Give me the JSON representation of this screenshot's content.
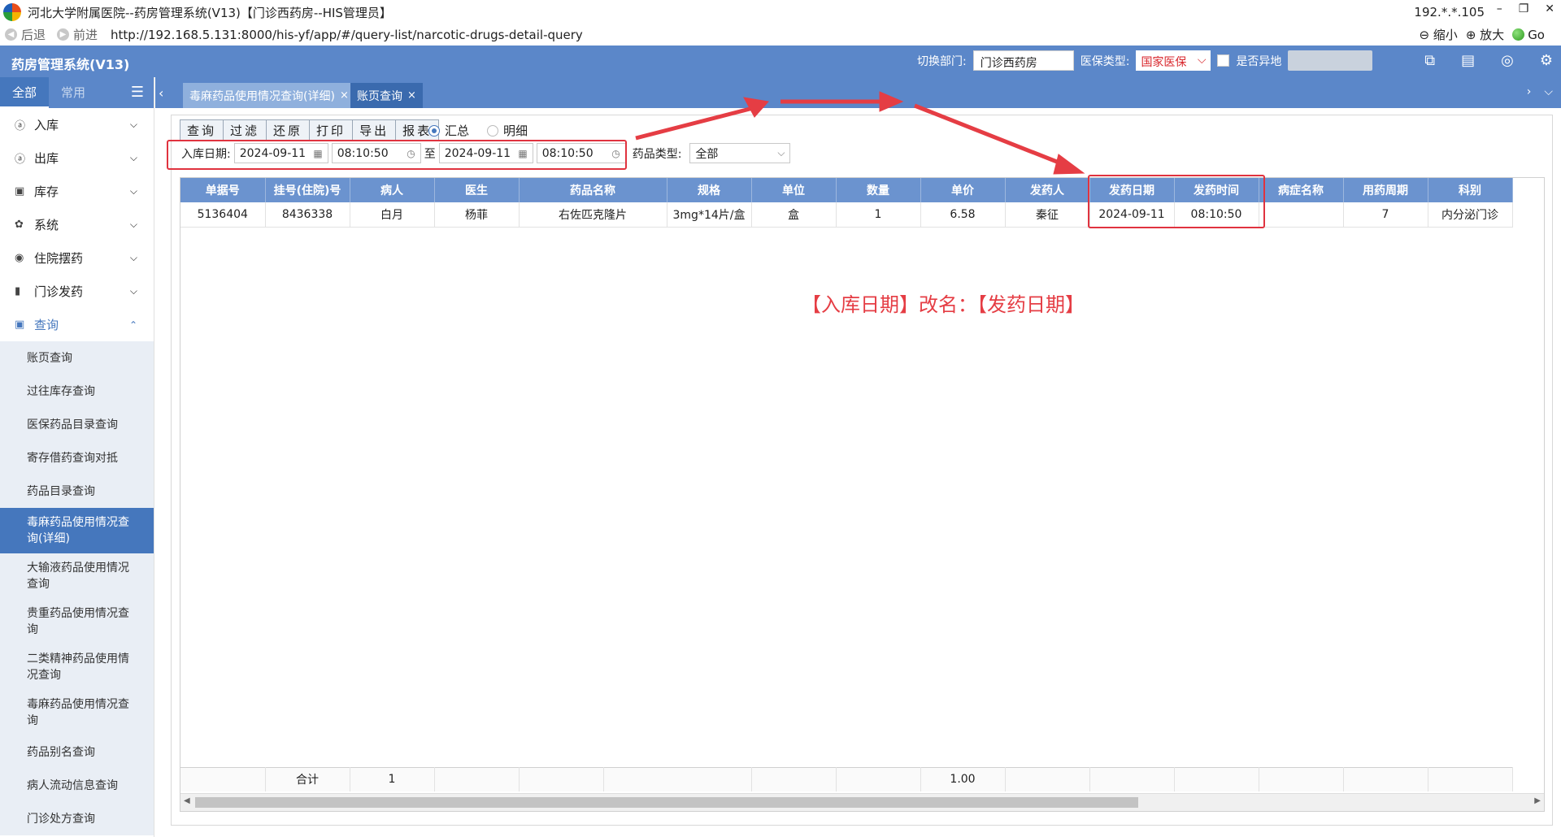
{
  "window": {
    "title": "河北大学附属医院--药房管理系统(V13)【门诊西药房--HIS管理员】",
    "ip": "192.*.*.105",
    "min": "–",
    "restore": "❐",
    "close": "✕"
  },
  "addressbar": {
    "back": "后退",
    "forward": "前进",
    "url": "http://192.168.5.131:8000/his-yf/app/#/query-list/narcotic-drugs-detail-query",
    "zoom_out": "缩小",
    "zoom_in": "放大",
    "go": "Go"
  },
  "header": {
    "app_title": "药房管理系统(V13)",
    "dept_label": "切换部门:",
    "dept_value": "门诊西药房",
    "insurance_label": "医保类型:",
    "insurance_value": "国家医保",
    "remote_label": "是否异地"
  },
  "sidebar": {
    "tabs": [
      "全部",
      "常用"
    ],
    "items": [
      {
        "label": "入库",
        "icon": "ⓐ"
      },
      {
        "label": "出库",
        "icon": "ⓐ"
      },
      {
        "label": "库存",
        "icon": "▣"
      },
      {
        "label": "系统",
        "icon": "✿"
      },
      {
        "label": "住院摆药",
        "icon": "◉"
      },
      {
        "label": "门诊发药",
        "icon": "▮"
      },
      {
        "label": "查询",
        "icon": "▣"
      }
    ],
    "submenu": [
      "账页查询",
      "过往库存查询",
      "医保药品目录查询",
      "寄存借药查询对抵",
      "药品目录查询",
      "毒麻药品使用情况查询(详细)",
      "大输液药品使用情况查询",
      "贵重药品使用情况查询",
      "二类精神药品使用情况查询",
      "毒麻药品使用情况查询",
      "药品别名查询",
      "病人流动信息查询",
      "门诊处方查询"
    ]
  },
  "tabs": [
    {
      "label": "毒麻药品使用情况查询(详细)",
      "close": "×"
    },
    {
      "label": "账页查询",
      "close": "×"
    }
  ],
  "toolbar": {
    "buttons": [
      "查询",
      "过滤",
      "还原",
      "打印",
      "导出",
      "报表"
    ],
    "radio_summary": "汇总",
    "radio_detail": "明细"
  },
  "filters": {
    "date_label": "入库日期:",
    "start_date": "2024-09-11",
    "start_time": "08:10:50",
    "to": "至",
    "end_date": "2024-09-11",
    "end_time": "08:10:50",
    "drug_type_label": "药品类型:",
    "drug_type_value": "全部"
  },
  "table": {
    "columns": [
      "单据号",
      "挂号(住院)号",
      "病人",
      "医生",
      "药品名称",
      "规格",
      "单位",
      "数量",
      "单价",
      "发药人",
      "发药日期",
      "发药时间",
      "病症名称",
      "用药周期",
      "科别"
    ],
    "rows": [
      [
        "5136404",
        "8436338",
        "白月",
        "杨菲",
        "右佐匹克隆片",
        "3mg*14片/盒",
        "盒",
        "1",
        "6.58",
        "秦征",
        "2024-09-11",
        "08:10:50",
        "",
        "7",
        "内分泌门诊"
      ]
    ],
    "footer": {
      "label": "合计",
      "count": "1",
      "qty": "1.00"
    }
  },
  "annotation": "【入库日期】改名：【发药日期】",
  "colors": {
    "header_blue": "#5b87c9",
    "active_blue": "#4577bd",
    "annotation_red": "#e53d44"
  }
}
